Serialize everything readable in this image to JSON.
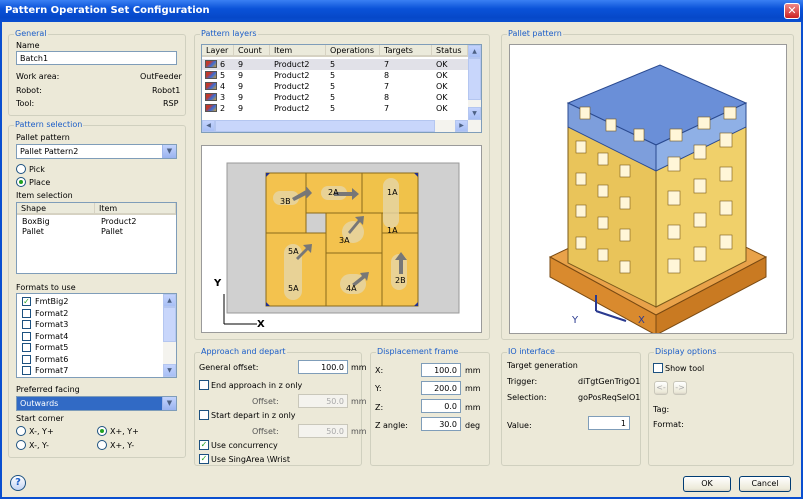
{
  "window": {
    "title": "Pattern Operation Set Configuration"
  },
  "general": {
    "legend": "General",
    "name_label": "Name",
    "name_value": "Batch1",
    "work_area_label": "Work area:",
    "work_area_value": "OutFeeder",
    "robot_label": "Robot:",
    "robot_value": "Robot1",
    "tool_label": "Tool:",
    "tool_value": "RSP"
  },
  "pattern_selection": {
    "legend": "Pattern selection",
    "pallet_pattern_label": "Pallet pattern",
    "pallet_pattern_value": "Pallet Pattern2",
    "pick_label": "Pick",
    "place_label": "Place",
    "item_selection_label": "Item selection",
    "item_columns": [
      "Shape",
      "Item"
    ],
    "items": [
      [
        "BoxBig",
        "Product2"
      ],
      [
        "Pallet",
        "Pallet"
      ]
    ],
    "formats_label": "Formats to use",
    "formats": [
      {
        "label": "FmtBig2",
        "checked": true
      },
      {
        "label": "Format2",
        "checked": false
      },
      {
        "label": "Format3",
        "checked": false
      },
      {
        "label": "Format4",
        "checked": false
      },
      {
        "label": "Format5",
        "checked": false
      },
      {
        "label": "Format6",
        "checked": false
      },
      {
        "label": "Format7",
        "checked": false
      }
    ],
    "preferred_facing_label": "Preferred facing",
    "preferred_facing_value": "Outwards",
    "start_corner_label": "Start corner",
    "corners": [
      "X-, Y+",
      "X+, Y+",
      "X-, Y-",
      "X+, Y-"
    ]
  },
  "pattern_layers": {
    "legend": "Pattern layers",
    "columns": [
      "Layer",
      "Count",
      "Item",
      "Operations",
      "Targets",
      "Status"
    ],
    "rows": [
      [
        "6",
        "9",
        "Product2",
        "5",
        "7",
        "OK"
      ],
      [
        "5",
        "9",
        "Product2",
        "5",
        "8",
        "OK"
      ],
      [
        "4",
        "9",
        "Product2",
        "5",
        "7",
        "OK"
      ],
      [
        "3",
        "9",
        "Product2",
        "5",
        "8",
        "OK"
      ],
      [
        "2",
        "9",
        "Product2",
        "5",
        "7",
        "OK"
      ]
    ]
  },
  "layer_view": {
    "x_axis": "X",
    "y_axis": "Y",
    "labels": [
      "3B",
      "2A",
      "1A",
      "1A",
      "3A",
      "5A",
      "5A",
      "4A",
      "2B"
    ]
  },
  "pallet_pattern": {
    "legend": "Pallet pattern",
    "x_axis": "X",
    "y_axis": "Y"
  },
  "approach": {
    "legend": "Approach and depart",
    "general_offset_label": "General offset:",
    "general_offset_value": "100.0",
    "unit": "mm",
    "end_approach_label": "End approach in z only",
    "offset_label": "Offset:",
    "offset1_value": "50.0",
    "start_depart_label": "Start depart in z only",
    "offset2_value": "50.0",
    "use_concurrency_label": "Use concurrency",
    "use_singarea_label": "Use SingArea \\Wrist"
  },
  "displacement": {
    "legend": "Displacement frame",
    "x_label": "X:",
    "x_value": "100.0",
    "y_label": "Y:",
    "y_value": "200.0",
    "z_label": "Z:",
    "z_value": "0.0",
    "zangle_label": "Z angle:",
    "zangle_value": "30.0",
    "unit_mm": "mm",
    "unit_deg": "deg"
  },
  "io": {
    "legend": "IO interface",
    "target_generation_label": "Target generation",
    "trigger_label": "Trigger:",
    "trigger_value": "diTgtGenTrigO1",
    "selection_label": "Selection:",
    "selection_value": "goPosReqSelO1",
    "value_label": "Value:",
    "value_value": "1"
  },
  "display": {
    "legend": "Display options",
    "show_tool_label": "Show tool",
    "prev_label": "<-",
    "next_label": "->",
    "tag_label": "Tag:",
    "format_label": "Format:"
  },
  "footer": {
    "ok_label": "OK",
    "cancel_label": "Cancel"
  }
}
